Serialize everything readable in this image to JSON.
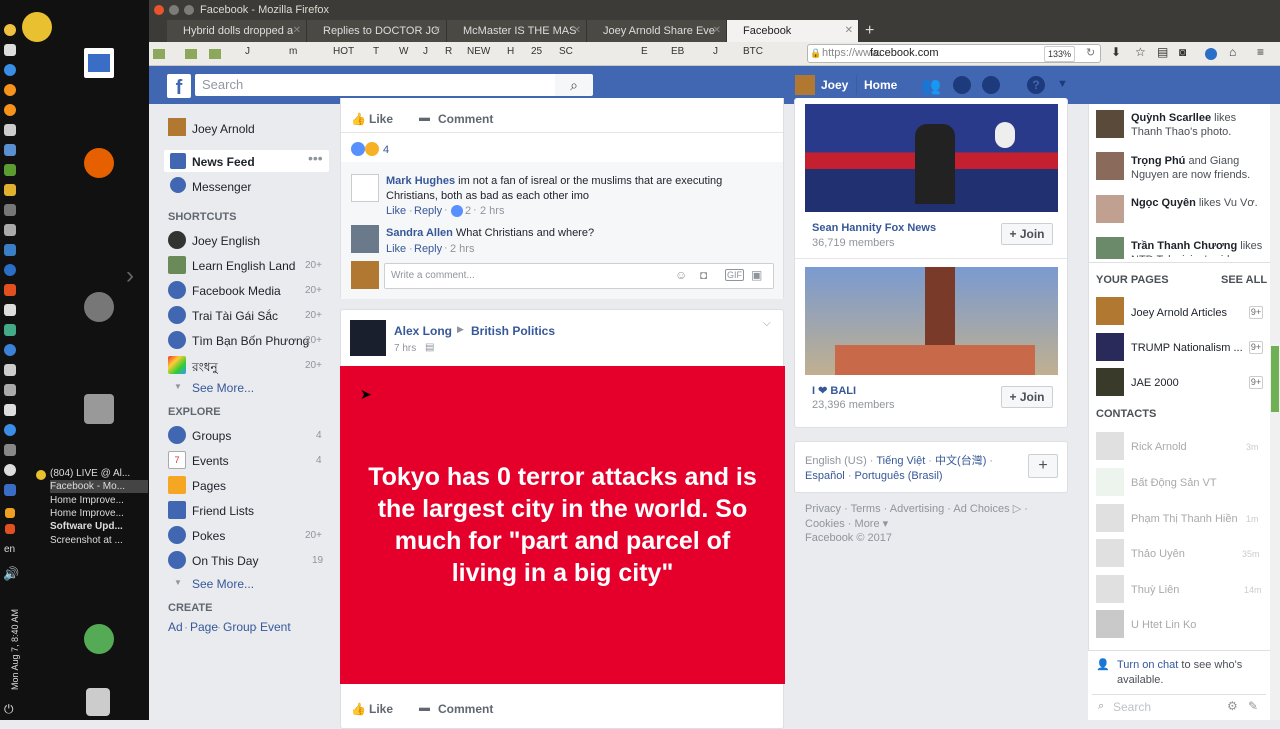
{
  "window": {
    "title": "Facebook - Mozilla Firefox"
  },
  "tabs": [
    {
      "label": "Hybrid dolls dropped a"
    },
    {
      "label": "Replies to DOCTOR JO"
    },
    {
      "label": "McMaster IS THE MAS"
    },
    {
      "label": "Joey Arnold Share Eve"
    },
    {
      "label": "Facebook"
    }
  ],
  "bookmarks": [
    "J",
    "m",
    "HOT",
    "T",
    "W",
    "J",
    "R",
    "NEW",
    "H",
    "25",
    "SC",
    "E",
    "EB",
    "J",
    "BTC"
  ],
  "url": {
    "prefix": "https://www.",
    "domain": "facebook.com",
    "zoom": "133%"
  },
  "taskbar": {
    "windows": [
      "(804) LIVE @ Al...",
      "Facebook - Mo...",
      "Home Improve...",
      "Home Improve...",
      "Software Upd...",
      "Screenshot at ..."
    ],
    "lang": "en",
    "clock": "Mon Aug 7, 8:40 AM"
  },
  "topbar": {
    "search_placeholder": "Search",
    "user": "Joey",
    "home": "Home"
  },
  "leftnav": {
    "profile": "Joey Arnold",
    "news_feed": "News Feed",
    "messenger": "Messenger",
    "shortcuts_title": "SHORTCUTS",
    "shortcuts": [
      {
        "label": "Joey English",
        "count": ""
      },
      {
        "label": "Learn English Land",
        "count": "20+"
      },
      {
        "label": "Facebook Media",
        "count": "20+"
      },
      {
        "label": "Trai Tài Gái Sắc",
        "count": "20+"
      },
      {
        "label": "Tìm Bạn Bốn Phương",
        "count": "20+"
      },
      {
        "label": "রংধনু",
        "count": "20+"
      }
    ],
    "see_more": "See More...",
    "explore_title": "EXPLORE",
    "explore": [
      {
        "label": "Groups",
        "count": "4"
      },
      {
        "label": "Events",
        "count": "4"
      },
      {
        "label": "Pages",
        "count": ""
      },
      {
        "label": "Friend Lists",
        "count": ""
      },
      {
        "label": "Pokes",
        "count": "20+"
      },
      {
        "label": "On This Day",
        "count": "19"
      }
    ],
    "see_more2": "See More...",
    "create_title": "CREATE",
    "create_links": [
      "Ad",
      "Page",
      "Group",
      "Event"
    ]
  },
  "post1": {
    "like": "Like",
    "comment": "Comment",
    "reaction_count": "4",
    "comments": [
      {
        "author": "Mark Hughes",
        "text": "im not a fan of isreal or the muslims that are executing Christians, both as bad as each other imo",
        "like": "Like",
        "reply": "Reply",
        "likes": "2",
        "time": "2 hrs"
      },
      {
        "author": "Sandra Allen",
        "text": "What Christians and where?",
        "like": "Like",
        "reply": "Reply",
        "time": "2 hrs"
      }
    ],
    "write_placeholder": "Write a comment..."
  },
  "post2": {
    "author": "Alex Long",
    "target": "British Politics",
    "time": "7 hrs",
    "text": "Tokyo has 0 terror attacks and is the largest city in the world. So much for \"part and parcel of living in a big city\"",
    "bg_color": "#e4002b",
    "like": "Like",
    "comment": "Comment"
  },
  "groups": [
    {
      "name": "Sean Hannity Fox News",
      "members": "36,719 members",
      "join": "Join"
    },
    {
      "name": "I ❤ BALI",
      "members": "23,396 members",
      "join": "Join"
    }
  ],
  "langs": {
    "current": "English (US)",
    "others": [
      "Tiếng Việt",
      "中文(台灣)",
      "Español",
      "Português (Brasil)"
    ]
  },
  "footer": {
    "links": [
      "Privacy",
      "Terms",
      "Advertising",
      "Ad Choices",
      "Cookies",
      "More"
    ],
    "copyright": "Facebook © 2017"
  },
  "ticker": [
    {
      "name": "Quỳnh Scarllee",
      "rest": " likes Thanh Thao's photo."
    },
    {
      "name": "Trọng Phú",
      "rest": " and Giang Nguyen are now friends."
    },
    {
      "name": "Ngọc Quyên",
      "rest": " likes Vu Vơ."
    },
    {
      "name": "Trần Thanh Chương",
      "rest": " likes NTD Television's video."
    }
  ],
  "your_pages": {
    "title": "YOUR PAGES",
    "see_all": "SEE ALL",
    "items": [
      {
        "name": "Joey Arnold Articles",
        "badge": "9+"
      },
      {
        "name": "TRUMP Nationalism ...",
        "badge": "9+"
      },
      {
        "name": "JAE 2000",
        "badge": "9+"
      }
    ]
  },
  "contacts": {
    "title": "CONTACTS",
    "items": [
      {
        "name": "Rick Arnold",
        "time": "3m"
      },
      {
        "name": "Bất Động Sản VT",
        "time": ""
      },
      {
        "name": "Phạm Thị Thanh Hiền",
        "time": "1m"
      },
      {
        "name": "Thảo Uyên",
        "time": "35m"
      },
      {
        "name": "Thuỳ Liên",
        "time": "14m"
      },
      {
        "name": "U Htet Lin Ko",
        "time": ""
      }
    ]
  },
  "chat": {
    "turn_on": "Turn on chat",
    "rest": " to see who's available.",
    "search": "Search"
  }
}
